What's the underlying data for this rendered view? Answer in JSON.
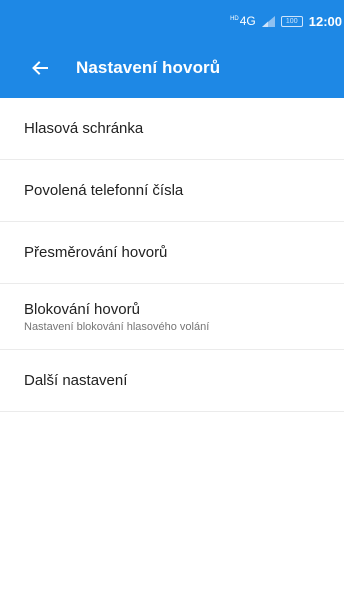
{
  "status_bar": {
    "network_badge": "HD",
    "network_type": "4G",
    "battery_level": "100",
    "time": "12:00",
    "icons": [
      "signal-icon",
      "battery-icon"
    ]
  },
  "app_bar": {
    "back_icon": "arrow-left-icon",
    "title": "Nastavení hovorů"
  },
  "settings": {
    "items": [
      {
        "title": "Hlasová schránka"
      },
      {
        "title": "Povolená telefonní čísla"
      },
      {
        "title": "Přesměrování hovorů"
      },
      {
        "title": "Blokování hovorů",
        "subtitle": "Nastavení blokování hlasového volání"
      },
      {
        "title": "Další nastavení"
      }
    ]
  },
  "colors": {
    "primary": "#1e88e5",
    "accent": "#e2186f",
    "text_primary": "#212121",
    "text_secondary": "#757575",
    "divider": "#ebebeb"
  }
}
